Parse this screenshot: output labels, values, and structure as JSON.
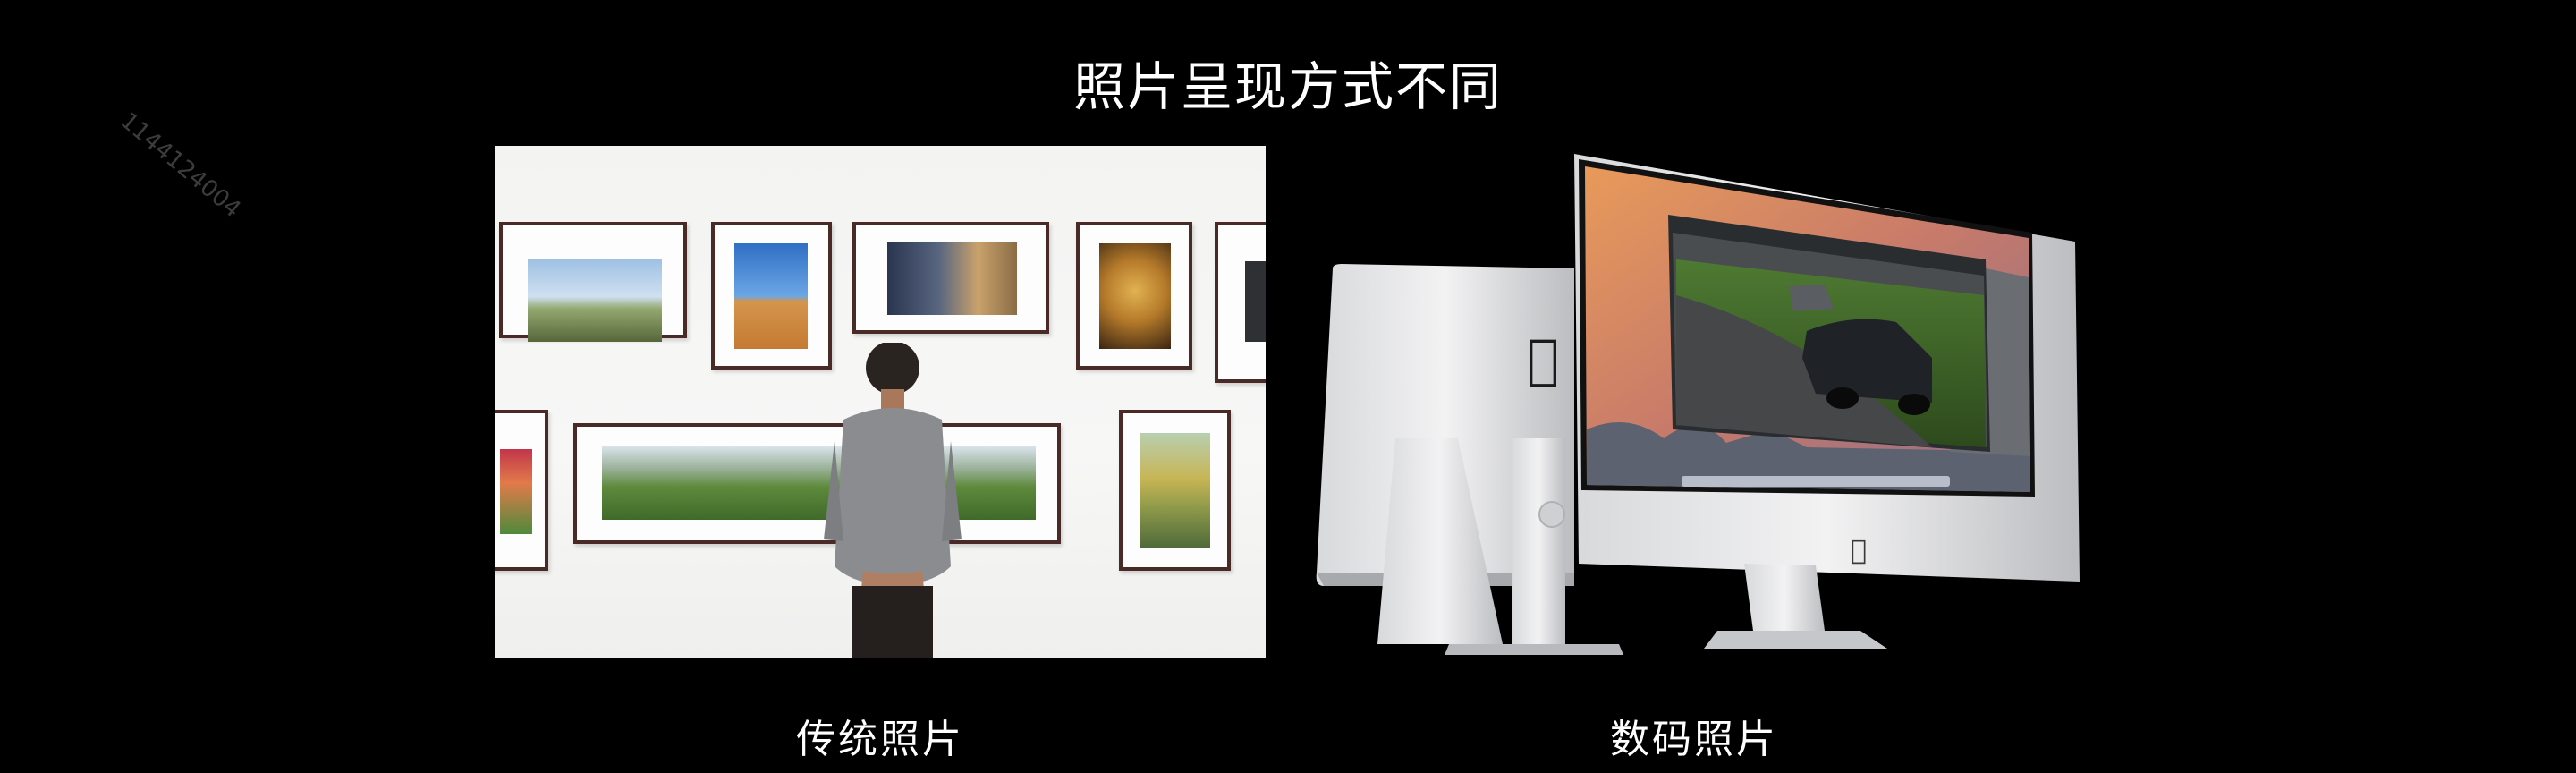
{
  "slide": {
    "title": "照片呈现方式不同",
    "watermark": "1144124004",
    "captions": {
      "traditional": "传统照片",
      "digital": "数码照片"
    }
  },
  "images": {
    "gallery": "gallery-visitor-photo",
    "imac": "imac-computers"
  },
  "colors": {
    "background": "#000000",
    "text": "#ffffff",
    "frame": "#4a2a26"
  }
}
